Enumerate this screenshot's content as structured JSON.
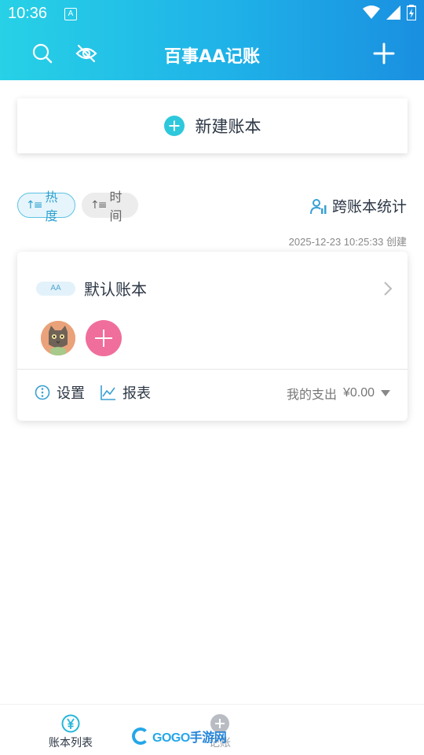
{
  "status_bar": {
    "time": "10:36",
    "notification_letter": "A"
  },
  "header": {
    "title": "百事AA记账"
  },
  "new_ledger": {
    "label": "新建账本"
  },
  "sort": {
    "hot_label": "热度",
    "time_label": "时间",
    "active": "热度"
  },
  "cross_ledger": {
    "label": "跨账本统计"
  },
  "ledger": {
    "created_at": "2025-12-23 10:25:33 创建",
    "tag": "AA",
    "name": "默认账本",
    "settings_label": "设置",
    "report_label": "报表",
    "expense_label": "我的支出",
    "expense_value": "¥0.00"
  },
  "bottom_nav": {
    "items": [
      {
        "label": "账本列表",
        "icon": "yen-circle-icon",
        "active": true
      },
      {
        "label": "记账",
        "icon": "plus-circle-icon",
        "active": false
      }
    ]
  },
  "watermark": {
    "text_latin": "GOGO",
    "text_cn": "手游网"
  },
  "colors": {
    "header_start": "#27d1e6",
    "header_end": "#1a8fe0",
    "accent": "#2ec8dc",
    "add_member": "#f06e9c"
  }
}
